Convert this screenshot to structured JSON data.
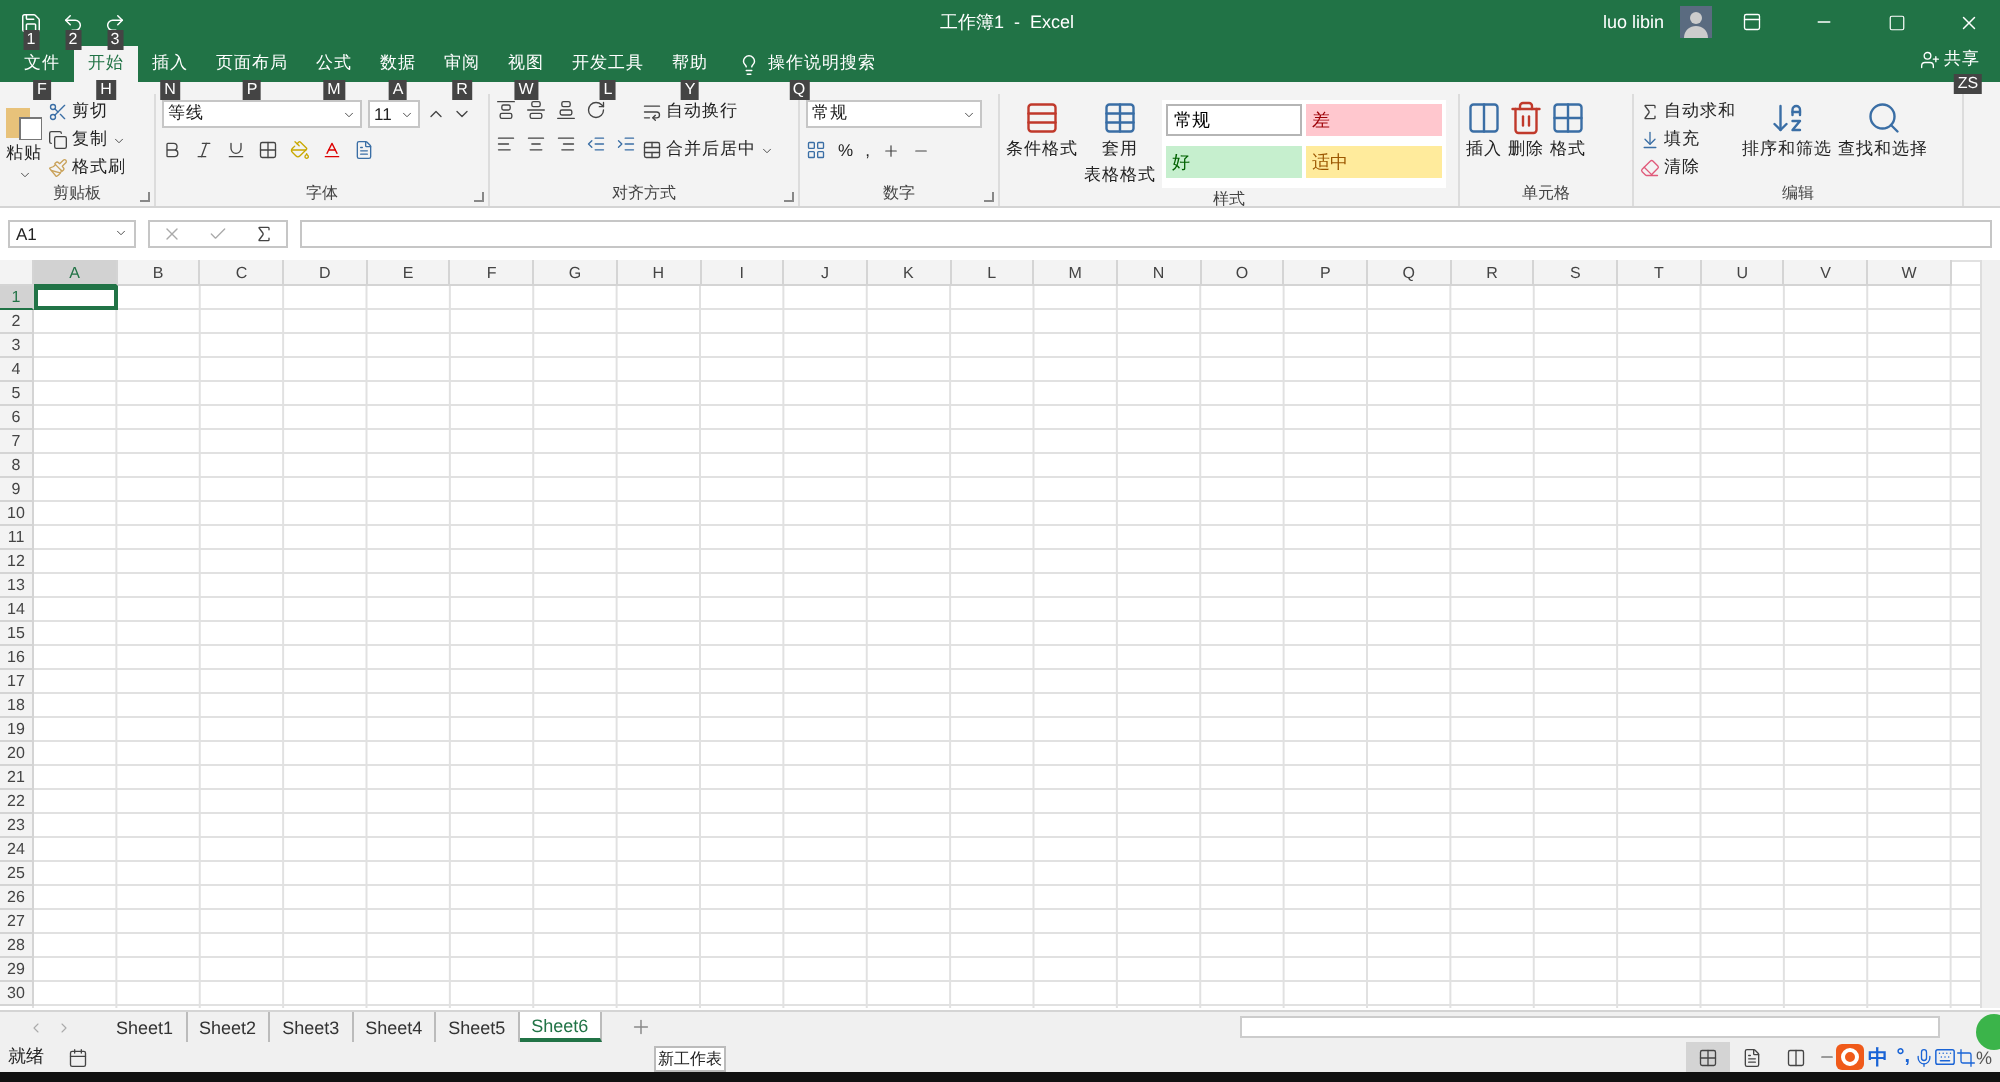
{
  "quick_access": [
    {
      "kind": "save",
      "keytip": "1"
    },
    {
      "kind": "undo",
      "keytip": "2"
    },
    {
      "kind": "redo",
      "keytip": "3"
    }
  ],
  "window": {
    "title": "工作簿1  -  Excel",
    "user": "luo libin"
  },
  "tabs": [
    {
      "label": "文件",
      "keytip": "F",
      "selected": false
    },
    {
      "label": "开始",
      "keytip": "H",
      "selected": true
    },
    {
      "label": "插入",
      "keytip": "N",
      "selected": false
    },
    {
      "label": "页面布局",
      "keytip": "P",
      "selected": false
    },
    {
      "label": "公式",
      "keytip": "M",
      "selected": false
    },
    {
      "label": "数据",
      "keytip": "A",
      "selected": false
    },
    {
      "label": "审阅",
      "keytip": "R",
      "selected": false
    },
    {
      "label": "视图",
      "keytip": "W",
      "selected": false
    },
    {
      "label": "开发工具",
      "keytip": "L",
      "selected": false
    },
    {
      "label": "帮助",
      "keytip": "Y",
      "selected": false
    }
  ],
  "tell_me": {
    "label": "操作说明搜索",
    "keytip": "Q"
  },
  "share": {
    "label": "共享",
    "keytip": "ZS"
  },
  "clipboard": {
    "paste": "粘贴",
    "cut": "剪切",
    "copy": "复制",
    "painter": "格式刷",
    "label": "剪贴板"
  },
  "font": {
    "name": "等线",
    "size": "11",
    "label": "字体"
  },
  "alignment": {
    "wrap": "自动换行",
    "merge": "合并后居中",
    "label": "对齐方式"
  },
  "number": {
    "format": "常规",
    "percent": "%",
    "comma": ",",
    "label": "数字"
  },
  "styles": {
    "conditional": "条件格式",
    "table_1": "套用",
    "table_2": "表格格式",
    "label": "样式",
    "cells": [
      {
        "label": "常规",
        "kind": "normal"
      },
      {
        "label": "差",
        "kind": "bad"
      },
      {
        "label": "好",
        "kind": "good"
      },
      {
        "label": "适中",
        "kind": "neutral"
      }
    ]
  },
  "cells": {
    "insert": "插入",
    "delete": "删除",
    "format": "格式",
    "label": "单元格"
  },
  "editing": {
    "autosum": "自动求和",
    "fill": "填充",
    "clear": "清除",
    "sort": "排序和筛选",
    "find": "查找和选择",
    "label": "编辑"
  },
  "formula_bar": {
    "name_box": "A1"
  },
  "grid": {
    "columns": [
      {
        "label": "A",
        "selected": true
      },
      {
        "label": "B",
        "selected": false
      },
      {
        "label": "C",
        "selected": false
      },
      {
        "label": "D",
        "selected": false
      },
      {
        "label": "E",
        "selected": false
      },
      {
        "label": "F",
        "selected": false
      },
      {
        "label": "G",
        "selected": false
      },
      {
        "label": "H",
        "selected": false
      },
      {
        "label": "I",
        "selected": false
      },
      {
        "label": "J",
        "selected": false
      },
      {
        "label": "K",
        "selected": false
      },
      {
        "label": "L",
        "selected": false
      },
      {
        "label": "M",
        "selected": false
      },
      {
        "label": "N",
        "selected": false
      },
      {
        "label": "O",
        "selected": false
      },
      {
        "label": "P",
        "selected": false
      },
      {
        "label": "Q",
        "selected": false
      },
      {
        "label": "R",
        "selected": false
      },
      {
        "label": "S",
        "selected": false
      },
      {
        "label": "T",
        "selected": false
      },
      {
        "label": "U",
        "selected": false
      },
      {
        "label": "V",
        "selected": false
      },
      {
        "label": "W",
        "selected": false
      }
    ],
    "rows": [
      {
        "label": "1",
        "selected": true
      },
      {
        "label": "2",
        "selected": false
      },
      {
        "label": "3",
        "selected": false
      },
      {
        "label": "4",
        "selected": false
      },
      {
        "label": "5",
        "selected": false
      },
      {
        "label": "6",
        "selected": false
      },
      {
        "label": "7",
        "selected": false
      },
      {
        "label": "8",
        "selected": false
      },
      {
        "label": "9",
        "selected": false
      },
      {
        "label": "10",
        "selected": false
      },
      {
        "label": "11",
        "selected": false
      },
      {
        "label": "12",
        "selected": false
      },
      {
        "label": "13",
        "selected": false
      },
      {
        "label": "14",
        "selected": false
      },
      {
        "label": "15",
        "selected": false
      },
      {
        "label": "16",
        "selected": false
      },
      {
        "label": "17",
        "selected": false
      },
      {
        "label": "18",
        "selected": false
      },
      {
        "label": "19",
        "selected": false
      },
      {
        "label": "20",
        "selected": false
      },
      {
        "label": "21",
        "selected": false
      },
      {
        "label": "22",
        "selected": false
      },
      {
        "label": "23",
        "selected": false
      },
      {
        "label": "24",
        "selected": false
      },
      {
        "label": "25",
        "selected": false
      },
      {
        "label": "26",
        "selected": false
      },
      {
        "label": "27",
        "selected": false
      },
      {
        "label": "28",
        "selected": false
      },
      {
        "label": "29",
        "selected": false
      },
      {
        "label": "30",
        "selected": false
      }
    ]
  },
  "sheets": [
    {
      "label": "Sheet1",
      "selected": false
    },
    {
      "label": "Sheet2",
      "selected": false
    },
    {
      "label": "Sheet3",
      "selected": false
    },
    {
      "label": "Sheet4",
      "selected": false
    },
    {
      "label": "Sheet5",
      "selected": false
    },
    {
      "label": "Sheet6",
      "selected": true
    }
  ],
  "tooltip": "新工作表",
  "status_bar": {
    "status": "就绪",
    "zoom": "%"
  },
  "ime": {
    "mode": "中",
    "punct": "°,"
  }
}
